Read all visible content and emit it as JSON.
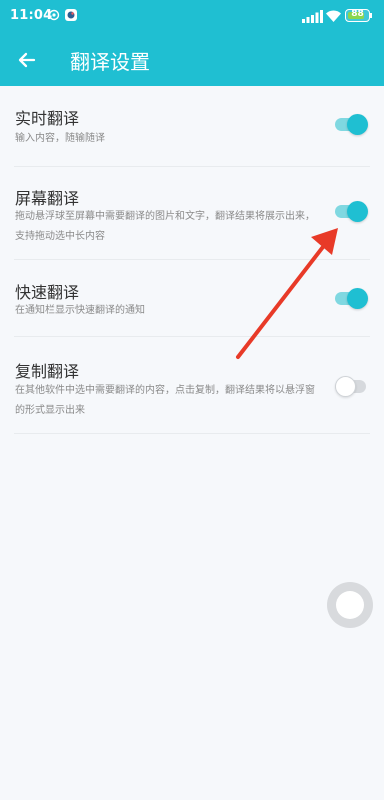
{
  "status_bar": {
    "time": "11:04",
    "battery": "88",
    "battery_level": 0.88
  },
  "app_bar": {
    "title": "翻译设置",
    "back_icon": "arrow-left-icon"
  },
  "settings": [
    {
      "title": "实时翻译",
      "description": "输入内容，随输随译",
      "enabled": true
    },
    {
      "title": "屏幕翻译",
      "description": "拖动悬浮球至屏幕中需要翻译的图片和文字，翻译结果将展示出来，支持拖动选中长内容",
      "enabled": true
    },
    {
      "title": "快速翻译",
      "description": "在通知栏显示快速翻译的通知",
      "enabled": true
    },
    {
      "title": "复制翻译",
      "description": "在其他软件中选中需要翻译的内容，点击复制，翻译结果将以悬浮窗的形式显示出来",
      "enabled": false
    }
  ],
  "colors": {
    "accent": "#1fbfd2",
    "annotation": "#e83a28"
  }
}
